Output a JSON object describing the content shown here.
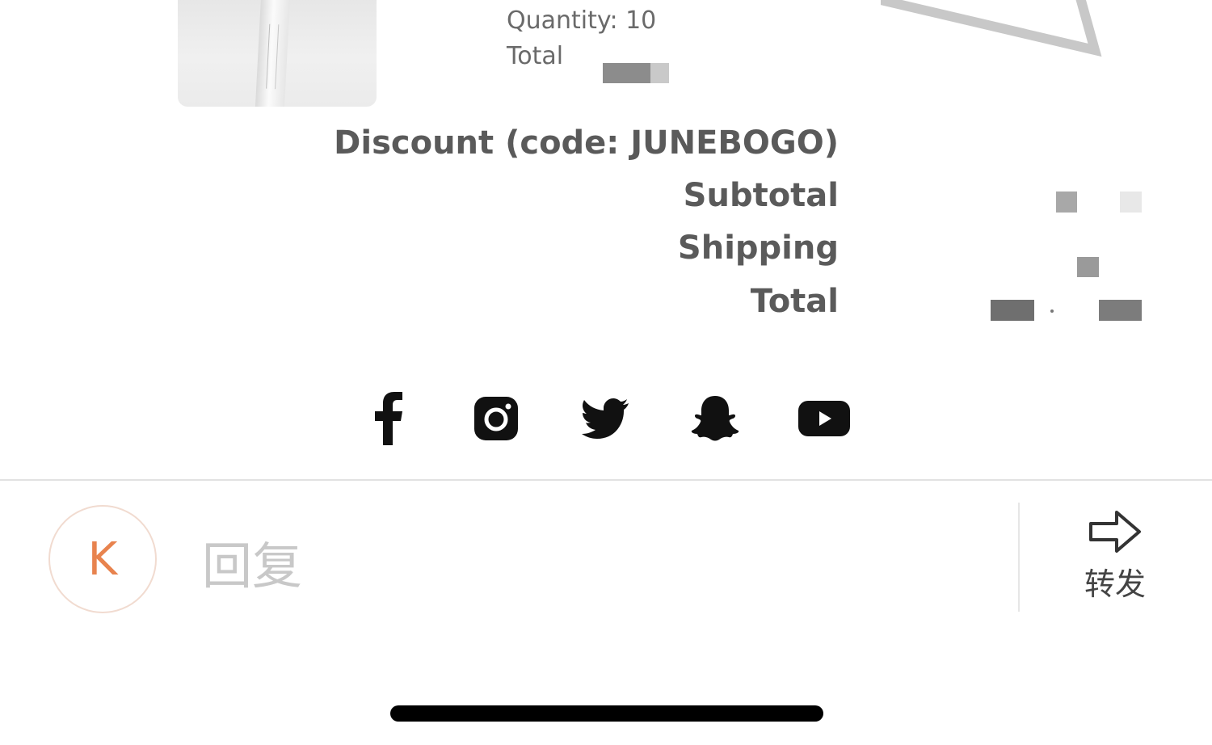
{
  "order_item": {
    "quantity_text": "Quantity: 10",
    "total_label": "Total"
  },
  "summary": {
    "discount_label": "Discount (code: JUNEBOGO)",
    "subtotal_label": "Subtotal",
    "shipping_label": "Shipping",
    "total_label": "Total"
  },
  "social": [
    {
      "icon": "facebook-icon"
    },
    {
      "icon": "instagram-icon"
    },
    {
      "icon": "twitter-icon"
    },
    {
      "icon": "snapchat-icon"
    },
    {
      "icon": "youtube-icon"
    }
  ],
  "reply_bar": {
    "avatar_initial": "K",
    "reply_placeholder": "回复",
    "forward_label": "转发"
  },
  "colors": {
    "avatar_accent": "#e8834e",
    "label_text": "#5a5a5a"
  }
}
